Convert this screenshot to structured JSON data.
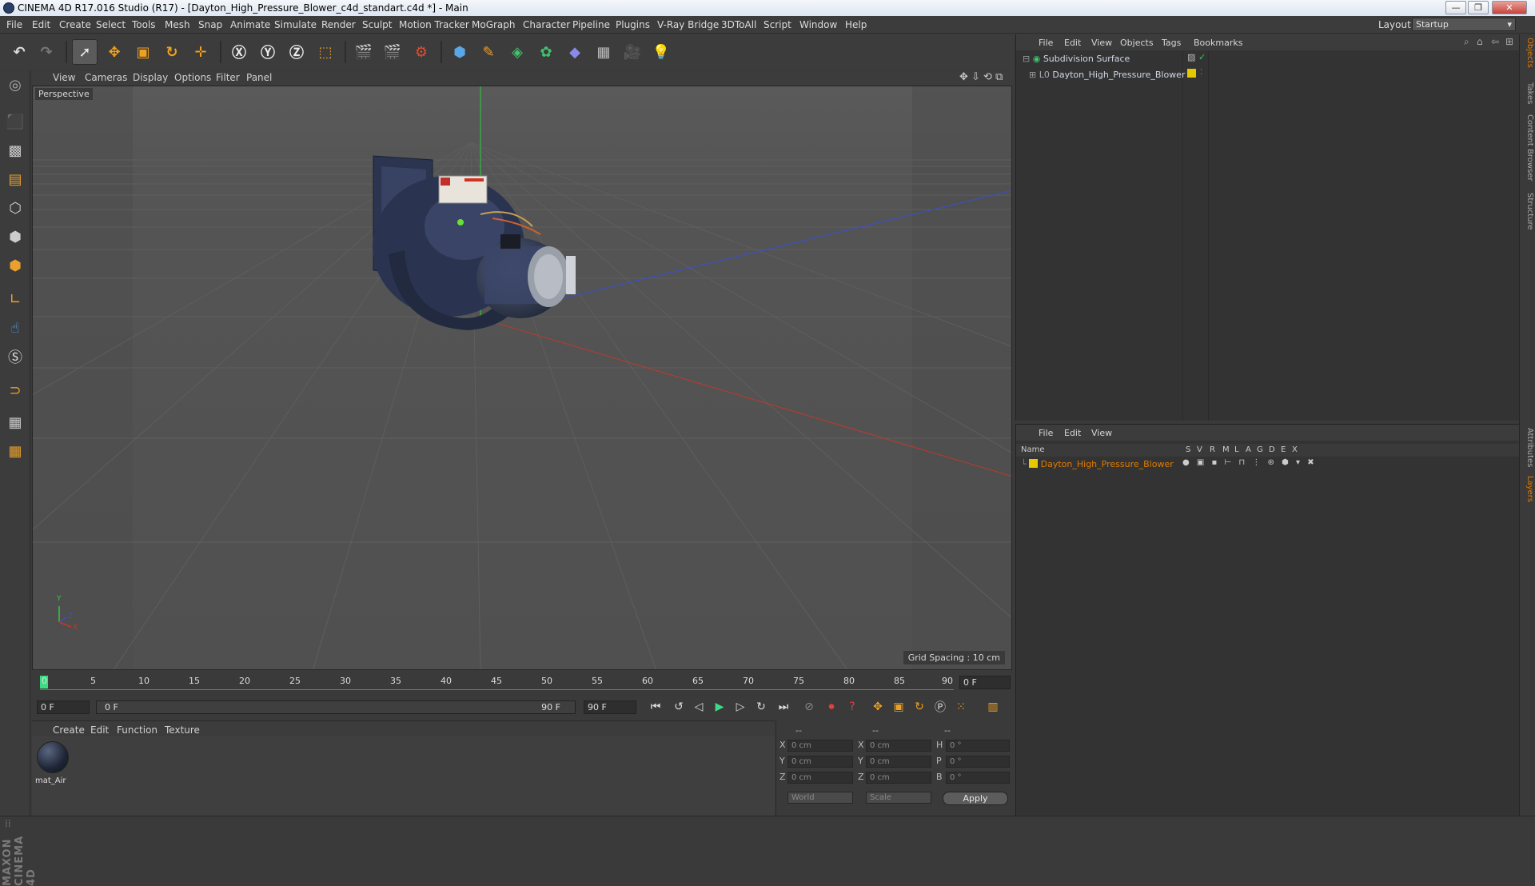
{
  "window": {
    "title": "CINEMA 4D R17.016 Studio (R17) - [Dayton_High_Pressure_Blower_c4d_standart.c4d *] - Main",
    "minimize": "—",
    "maximize": "❐",
    "close": "✕"
  },
  "menubar": {
    "items": [
      "File",
      "Edit",
      "Create",
      "Select",
      "Tools",
      "Mesh",
      "Snap",
      "Animate",
      "Simulate",
      "Render",
      "Sculpt",
      "Motion Tracker",
      "MoGraph",
      "Character",
      "Pipeline",
      "Plugins",
      "V-Ray Bridge",
      "3DToAll",
      "Script",
      "Window",
      "Help"
    ],
    "layout_label": "Layout:",
    "layout_value": "Startup"
  },
  "viewport": {
    "menu": [
      "View",
      "Cameras",
      "Display",
      "Options",
      "Filter",
      "Panel"
    ],
    "camera_label": "Perspective",
    "grid_spacing": "Grid Spacing : 10 cm",
    "axis_y": "Y",
    "axis_x": "X",
    "axis_z": "Z"
  },
  "timeline": {
    "ticks": [
      "0",
      "5",
      "10",
      "15",
      "20",
      "25",
      "30",
      "35",
      "40",
      "45",
      "50",
      "55",
      "60",
      "65",
      "70",
      "75",
      "80",
      "85",
      "90"
    ],
    "current_frame": "0 F",
    "start_frame": "0 F",
    "range_start": "0 F",
    "range_end": "90 F",
    "end_frame": "90 F"
  },
  "materials": {
    "menu": [
      "Create",
      "Edit",
      "Function",
      "Texture"
    ],
    "items": [
      {
        "name": "mat_Air"
      }
    ]
  },
  "coordinates": {
    "headers": [
      "--",
      "--",
      "--"
    ],
    "rows": [
      {
        "a": "X",
        "av": "0 cm",
        "b": "X",
        "bv": "0 cm",
        "c": "H",
        "cv": "0 °"
      },
      {
        "a": "Y",
        "av": "0 cm",
        "b": "Y",
        "bv": "0 cm",
        "c": "P",
        "cv": "0 °"
      },
      {
        "a": "Z",
        "av": "0 cm",
        "b": "Z",
        "bv": "0 cm",
        "c": "B",
        "cv": "0 °"
      }
    ],
    "space": "World",
    "mode": "Scale",
    "apply": "Apply"
  },
  "objects": {
    "menu": [
      "File",
      "Edit",
      "View",
      "Objects",
      "Tags",
      "Bookmarks"
    ],
    "items": [
      {
        "name": "Subdivision Surface"
      },
      {
        "name": "Dayton_High_Pressure_Blower"
      }
    ]
  },
  "layers": {
    "menu": [
      "File",
      "Edit",
      "View"
    ],
    "columns": [
      "Name",
      "S",
      "V",
      "R",
      "M",
      "L",
      "A",
      "G",
      "D",
      "E",
      "X"
    ],
    "items": [
      {
        "name": "Dayton_High_Pressure_Blower",
        "color": "#e6c800"
      }
    ]
  },
  "side_tabs": [
    "Objects",
    "Takes",
    "Content Browser",
    "Structure",
    "Attributes",
    "Layers"
  ],
  "colors": {
    "accent_orange": "#e07b00",
    "layer_color": "#e6c800",
    "axis_x": "#c0392b",
    "axis_y": "#2ecc40",
    "axis_z": "#3a4fd0"
  }
}
